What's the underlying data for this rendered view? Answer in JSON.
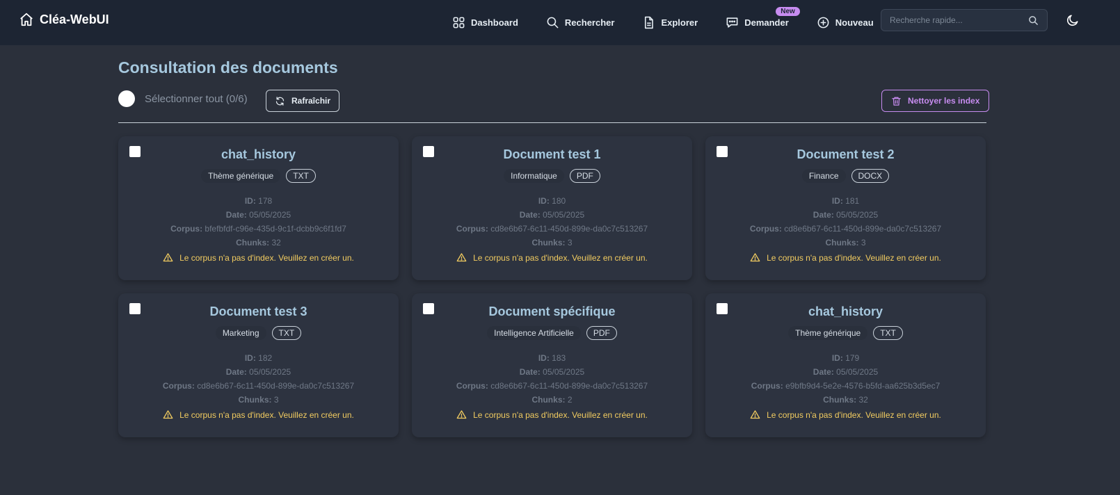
{
  "nav": {
    "brand": "Cléa-WebUI",
    "items": [
      {
        "label": "Dashboard",
        "icon": "dashboard-icon"
      },
      {
        "label": "Rechercher",
        "icon": "search-icon"
      },
      {
        "label": "Explorer",
        "icon": "document-icon"
      },
      {
        "label": "Demander",
        "icon": "chat-icon",
        "badge": "New"
      },
      {
        "label": "Nouveau",
        "icon": "plus-circle-icon"
      }
    ],
    "search_placeholder": "Recherche rapide...",
    "theme_icon": "moon-icon"
  },
  "header": {
    "title": "Consultation des documents",
    "select_all": "Sélectionner tout (0/6)",
    "refresh": "Rafraîchir",
    "clean": "Nettoyer les index"
  },
  "labels": {
    "id": "ID:",
    "date": "Date:",
    "corpus": "Corpus:",
    "chunks": "Chunks:"
  },
  "documents": [
    {
      "title": "chat_history",
      "theme": "Thème générique",
      "type": "TXT",
      "id": "178",
      "date": "05/05/2025",
      "corpus": "bfefbfdf-c96e-435d-9c1f-dcbb9c6f1fd7",
      "chunks": "32",
      "warning": "Le corpus n'a pas d'index. Veuillez en créer un."
    },
    {
      "title": "Document test 1",
      "theme": "Informatique",
      "type": "PDF",
      "id": "180",
      "date": "05/05/2025",
      "corpus": "cd8e6b67-6c11-450d-899e-da0c7c513267",
      "chunks": "3",
      "warning": "Le corpus n'a pas d'index. Veuillez en créer un."
    },
    {
      "title": "Document test 2",
      "theme": "Finance",
      "type": "DOCX",
      "id": "181",
      "date": "05/05/2025",
      "corpus": "cd8e6b67-6c11-450d-899e-da0c7c513267",
      "chunks": "3",
      "warning": "Le corpus n'a pas d'index. Veuillez en créer un."
    },
    {
      "title": "Document test 3",
      "theme": "Marketing",
      "type": "TXT",
      "id": "182",
      "date": "05/05/2025",
      "corpus": "cd8e6b67-6c11-450d-899e-da0c7c513267",
      "chunks": "3",
      "warning": "Le corpus n'a pas d'index. Veuillez en créer un."
    },
    {
      "title": "Document spécifique",
      "theme": "Intelligence Artificielle",
      "type": "PDF",
      "id": "183",
      "date": "05/05/2025",
      "corpus": "cd8e6b67-6c11-450d-899e-da0c7c513267",
      "chunks": "2",
      "warning": "Le corpus n'a pas d'index. Veuillez en créer un."
    },
    {
      "title": "chat_history",
      "theme": "Thème générique",
      "type": "TXT",
      "id": "179",
      "date": "05/05/2025",
      "corpus": "e9bfb9d4-5e2e-4576-b5fd-aa625b3d5ec7",
      "chunks": "32",
      "warning": "Le corpus n'a pas d'index. Veuillez en créer un."
    }
  ],
  "colors": {
    "navbar_bg": "#1d2533",
    "page_bg": "#2b303b",
    "card_bg": "#2d3340",
    "title_accent": "#a6c8de",
    "purple_accent": "#c78cf0",
    "warning": "#f2cc60"
  }
}
